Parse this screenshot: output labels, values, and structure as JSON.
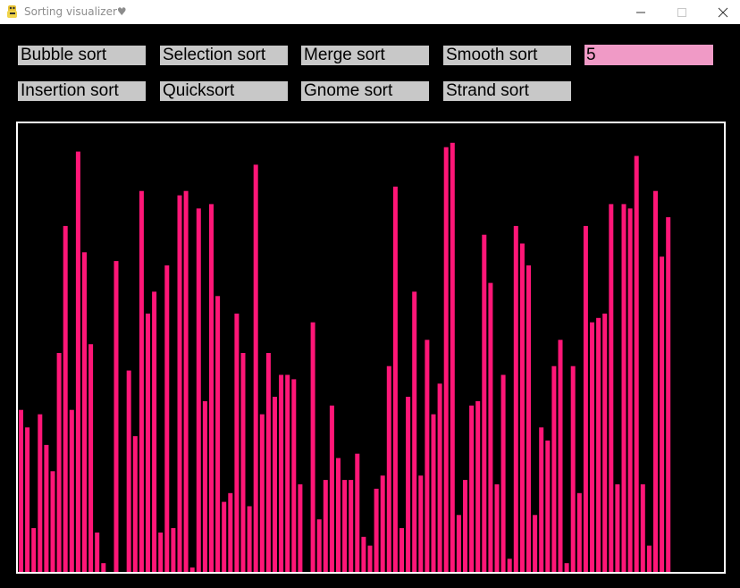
{
  "window": {
    "title": "Sorting visualizer♥",
    "min_icon": "minimize-icon",
    "max_icon": "maximize-icon",
    "close_icon": "close-icon"
  },
  "buttons": {
    "bubble": "Bubble sort",
    "selection": "Selection sort",
    "merge": "Merge sort",
    "smooth": "Smooth sort",
    "insertion": "Insertion sort",
    "quick": "Quicksort",
    "gnome": "Gnome sort",
    "strand": "Strand sort"
  },
  "count_input": {
    "value": "5"
  },
  "colors": {
    "bar": "#ff1677",
    "input": "#f09ac6",
    "button": "#c8c8c8"
  },
  "chart_data": {
    "type": "bar",
    "ylim": [
      0,
      100
    ],
    "values": [
      37,
      33,
      10,
      36,
      29,
      23,
      50,
      79,
      37,
      96,
      73,
      52,
      9,
      2,
      0,
      71,
      0,
      46,
      31,
      87,
      59,
      64,
      9,
      70,
      10,
      86,
      87,
      1,
      83,
      39,
      84,
      63,
      16,
      18,
      59,
      50,
      15,
      93,
      36,
      50,
      40,
      45,
      45,
      44,
      20,
      0,
      57,
      12,
      21,
      38,
      26,
      21,
      21,
      27,
      8,
      6,
      19,
      22,
      47,
      88,
      10,
      40,
      64,
      22,
      53,
      36,
      43,
      97,
      98,
      13,
      21,
      38,
      39,
      77,
      66,
      20,
      45,
      3,
      79,
      75,
      70,
      13,
      33,
      30,
      47,
      53,
      2,
      47,
      18,
      79,
      57,
      58,
      59,
      84,
      20,
      84,
      83,
      95,
      20,
      6,
      87,
      72,
      81
    ]
  }
}
